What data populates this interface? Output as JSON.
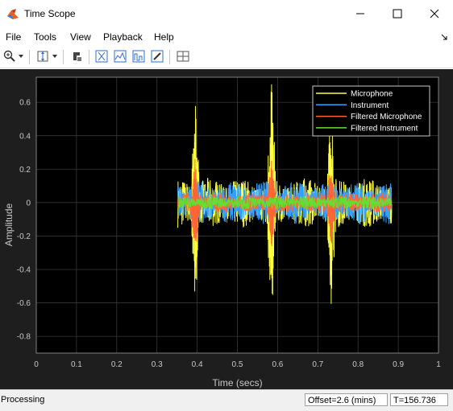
{
  "window": {
    "title": "Time Scope",
    "controls": [
      "minimize",
      "maximize",
      "close"
    ]
  },
  "menu": {
    "items": [
      "File",
      "Tools",
      "View",
      "Playback",
      "Help"
    ]
  },
  "toolbar": {
    "buttons": [
      "zoom-icon",
      "dropdown-arrow",
      "autoscale-icon",
      "dropdown-arrow",
      "cursor-icon",
      "trigger-icon",
      "measurement-icon",
      "peak-finder-icon",
      "edit-icon",
      "layout-icon"
    ]
  },
  "chart_data": {
    "type": "line",
    "xlabel": "Time (secs)",
    "ylabel": "Amplitude",
    "xlim": [
      0,
      1
    ],
    "ylim": [
      -0.9,
      0.75
    ],
    "xticks": [
      "0",
      "0.1",
      "0.2",
      "0.3",
      "0.4",
      "0.5",
      "0.6",
      "0.7",
      "0.8",
      "0.9",
      "1"
    ],
    "yticks": [
      "0.6",
      "0.4",
      "0.2",
      "0",
      "-0.2",
      "-0.4",
      "-0.6",
      "-0.8"
    ],
    "grid": true,
    "legend_position": "top-right",
    "background_color": "#000000",
    "series": [
      {
        "name": "Microphone",
        "color": "#ffff3b",
        "x_range": [
          0.352,
          0.884
        ],
        "amplitude": 0.15,
        "spikes": [
          [
            0.395,
            0.56,
            -0.62
          ],
          [
            0.585,
            0.65,
            -0.63
          ],
          [
            0.733,
            0.43,
            -0.62
          ]
        ]
      },
      {
        "name": "Instrument",
        "color": "#33a0ff",
        "x_range": [
          0.352,
          0.884
        ],
        "amplitude": 0.13,
        "spikes": []
      },
      {
        "name": "Filtered Microphone",
        "color": "#ff6633",
        "x_range": [
          0.352,
          0.884
        ],
        "amplitude": 0.06,
        "spikes": [
          [
            0.395,
            0.27,
            -0.3
          ],
          [
            0.585,
            0.25,
            -0.28
          ],
          [
            0.733,
            0.22,
            -0.25
          ]
        ]
      },
      {
        "name": "Filtered Instrument",
        "color": "#66dd33",
        "x_range": [
          0.352,
          0.884
        ],
        "amplitude": 0.04,
        "spikes": []
      }
    ]
  },
  "status": {
    "text": "Processing",
    "offset": "Offset=2.6 (mins)",
    "time": "T=156.736"
  }
}
